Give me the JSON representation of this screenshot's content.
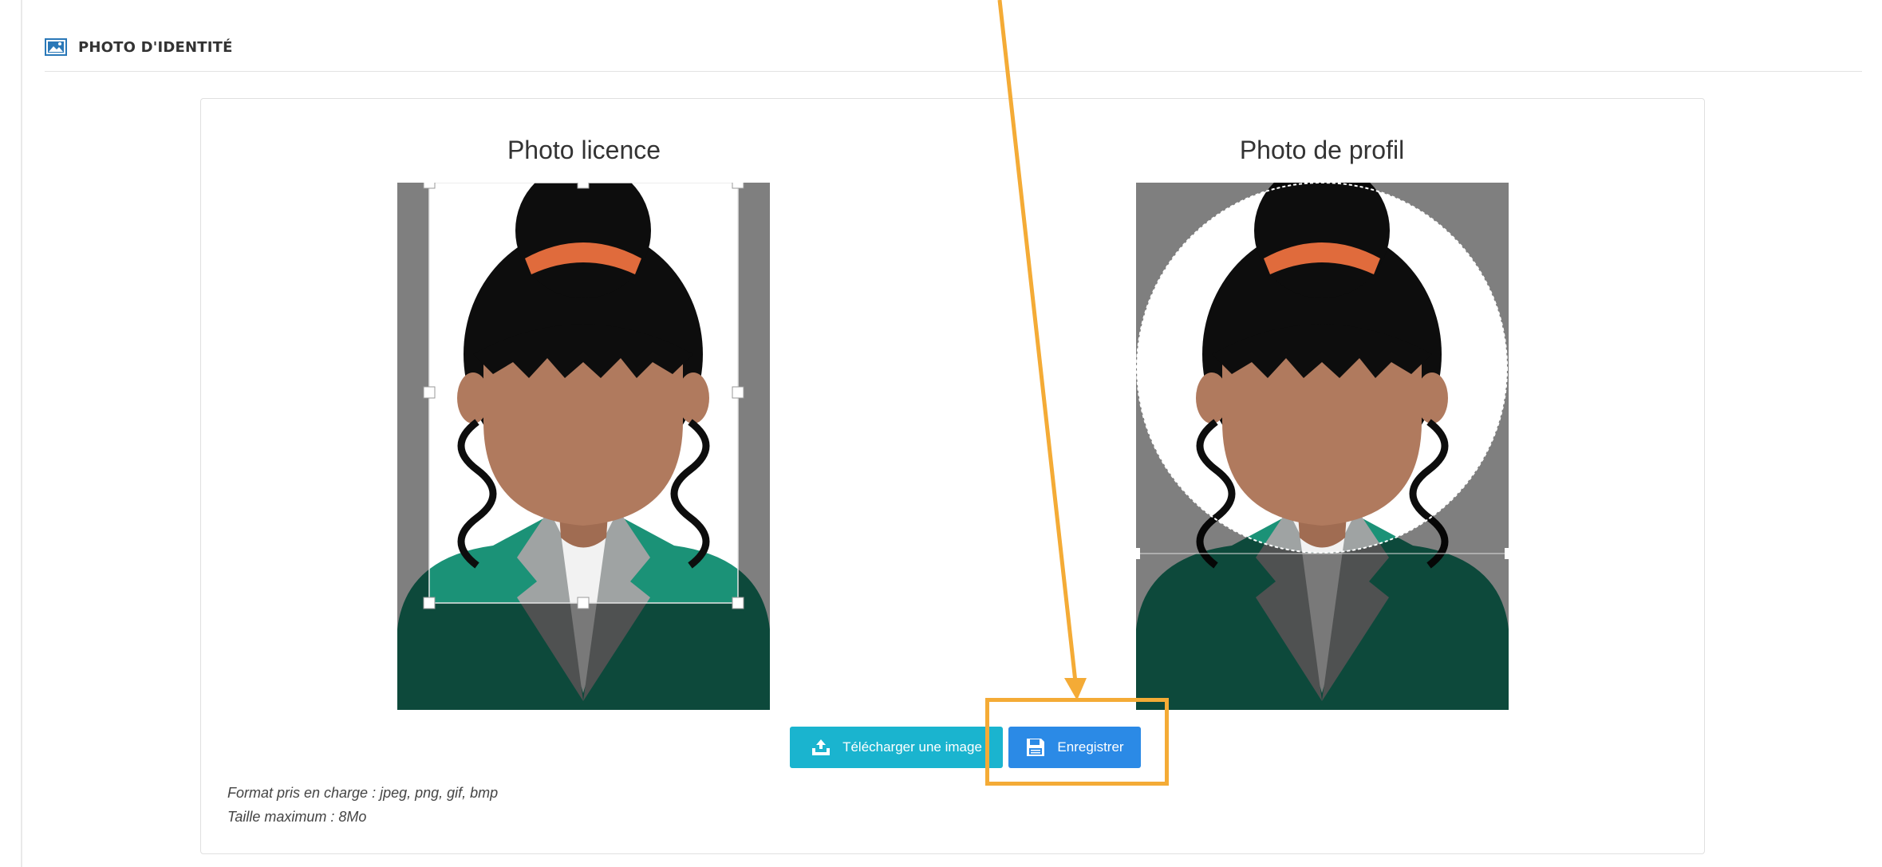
{
  "section": {
    "title": "PHOTO D'IDENTITÉ",
    "icon": "image-icon"
  },
  "panels": [
    {
      "title": "Photo licence",
      "crop_shape": "rectangle"
    },
    {
      "title": "Photo de profil",
      "crop_shape": "circle"
    }
  ],
  "buttons": {
    "upload": {
      "label": "Télécharger une image",
      "icon": "upload-icon",
      "color": "#1ab4cf"
    },
    "save": {
      "label": "Enregistrer",
      "icon": "floppy-disk-icon",
      "color": "#2b8ae6"
    }
  },
  "help": {
    "formats": "Format pris en charge : jpeg, png, gif, bmp",
    "max_size": "Taille maximum : 8Mo"
  },
  "annotation": {
    "color": "#f4ab36",
    "target": "save-button"
  },
  "colors": {
    "hair": "#0d0d0d",
    "skin": "#b07a5e",
    "hair_band": "#e06b3c",
    "jacket": "#1b9277",
    "lapel": "#9fa3a3",
    "shirt": "#f2f2f2"
  }
}
